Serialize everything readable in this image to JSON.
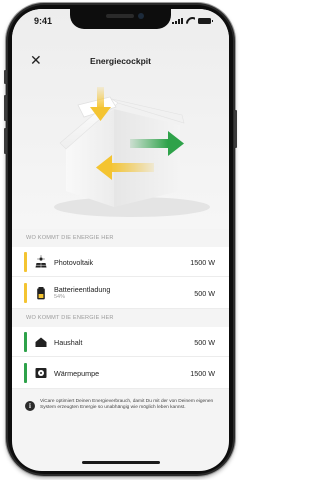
{
  "status_bar": {
    "time": "9:41"
  },
  "header": {
    "title": "Energiecockpit",
    "close_icon": "close-icon"
  },
  "colors": {
    "solar": "#f4c431",
    "battery": "#f4c431",
    "consumer": "#2ea24a"
  },
  "sources": {
    "header": "WO KOMMT DIE ENERGIE HER",
    "items": [
      {
        "label": "Photovoltaik",
        "sublabel": "",
        "value": "1500 W",
        "icon": "solar-panel-icon"
      },
      {
        "label": "Batterieentladung",
        "sublabel": "54%",
        "value": "500 W",
        "icon": "battery-icon"
      }
    ]
  },
  "consumers": {
    "header": "WO KOMMT DIE ENERGIE HER",
    "items": [
      {
        "label": "Haushalt",
        "value": "500 W",
        "icon": "house-icon"
      },
      {
        "label": "Wärmepumpe",
        "value": "1500 W",
        "icon": "heat-pump-icon"
      }
    ]
  },
  "info": {
    "icon": "info-icon",
    "text": "ViCare optimiert Deinen Energieverbrauch, damit Du mit der von Deinem eigenen System erzeugten Energie so unabhängig wie möglich leben kannst."
  }
}
